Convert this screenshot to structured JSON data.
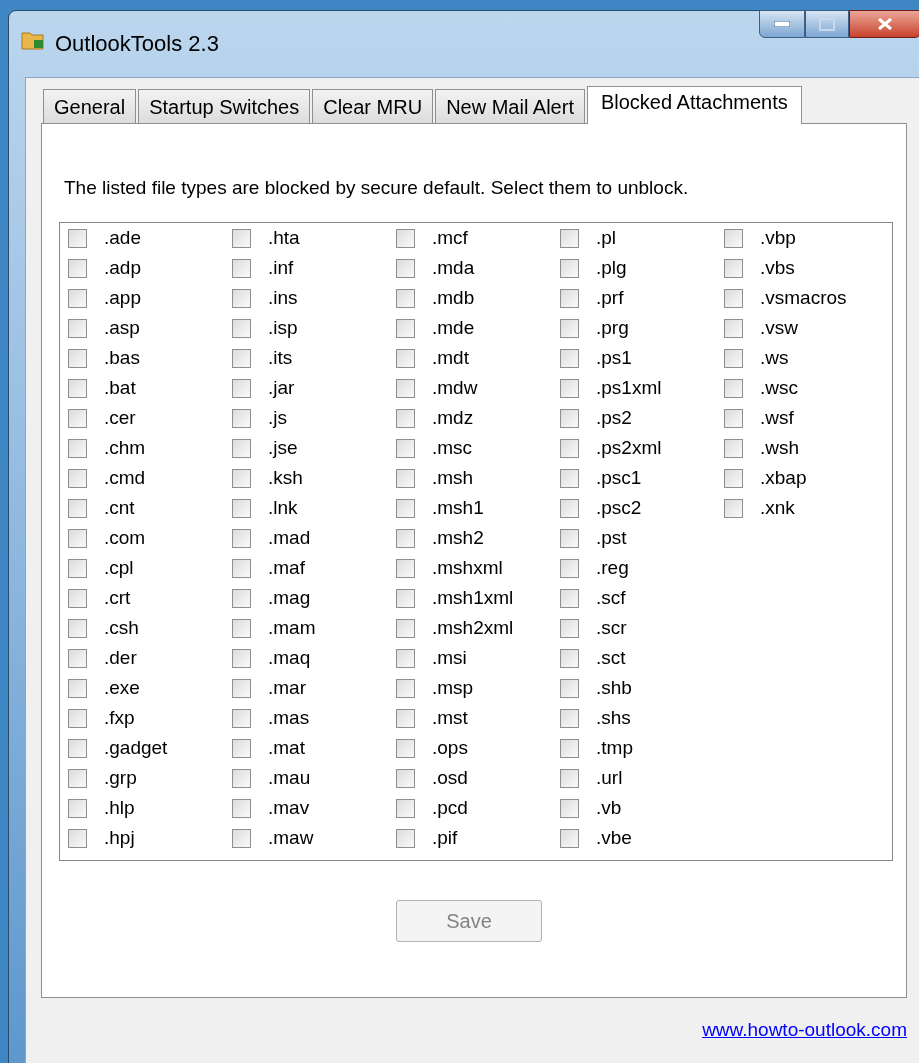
{
  "window": {
    "title": "OutlookTools 2.3"
  },
  "tabs": [
    {
      "label": "General",
      "selected": false
    },
    {
      "label": "Startup Switches",
      "selected": false
    },
    {
      "label": "Clear MRU",
      "selected": false
    },
    {
      "label": "New Mail Alert",
      "selected": false
    },
    {
      "label": "Blocked Attachments",
      "selected": true
    }
  ],
  "instructions": "The listed file types are blocked by secure default. Select them to unblock.",
  "file_types": [
    {
      "label": ".ade",
      "checked": false
    },
    {
      "label": ".adp",
      "checked": false
    },
    {
      "label": ".app",
      "checked": false
    },
    {
      "label": ".asp",
      "checked": false
    },
    {
      "label": ".bas",
      "checked": false
    },
    {
      "label": ".bat",
      "checked": false
    },
    {
      "label": ".cer",
      "checked": false
    },
    {
      "label": ".chm",
      "checked": false
    },
    {
      "label": ".cmd",
      "checked": false
    },
    {
      "label": ".cnt",
      "checked": false
    },
    {
      "label": ".com",
      "checked": false
    },
    {
      "label": ".cpl",
      "checked": false
    },
    {
      "label": ".crt",
      "checked": false
    },
    {
      "label": ".csh",
      "checked": false
    },
    {
      "label": ".der",
      "checked": false
    },
    {
      "label": ".exe",
      "checked": false
    },
    {
      "label": ".fxp",
      "checked": false
    },
    {
      "label": ".gadget",
      "checked": false
    },
    {
      "label": ".grp",
      "checked": false
    },
    {
      "label": ".hlp",
      "checked": false
    },
    {
      "label": ".hpj",
      "checked": false
    },
    {
      "label": ".hta",
      "checked": false
    },
    {
      "label": ".inf",
      "checked": false
    },
    {
      "label": ".ins",
      "checked": false
    },
    {
      "label": ".isp",
      "checked": false
    },
    {
      "label": ".its",
      "checked": false
    },
    {
      "label": ".jar",
      "checked": false
    },
    {
      "label": ".js",
      "checked": false
    },
    {
      "label": ".jse",
      "checked": false
    },
    {
      "label": ".ksh",
      "checked": false
    },
    {
      "label": ".lnk",
      "checked": false
    },
    {
      "label": ".mad",
      "checked": false
    },
    {
      "label": ".maf",
      "checked": false
    },
    {
      "label": ".mag",
      "checked": false
    },
    {
      "label": ".mam",
      "checked": false
    },
    {
      "label": ".maq",
      "checked": false
    },
    {
      "label": ".mar",
      "checked": false
    },
    {
      "label": ".mas",
      "checked": false
    },
    {
      "label": ".mat",
      "checked": false
    },
    {
      "label": ".mau",
      "checked": false
    },
    {
      "label": ".mav",
      "checked": false
    },
    {
      "label": ".maw",
      "checked": false
    },
    {
      "label": ".mcf",
      "checked": false
    },
    {
      "label": ".mda",
      "checked": false
    },
    {
      "label": ".mdb",
      "checked": false
    },
    {
      "label": ".mde",
      "checked": false
    },
    {
      "label": ".mdt",
      "checked": false
    },
    {
      "label": ".mdw",
      "checked": false
    },
    {
      "label": ".mdz",
      "checked": false
    },
    {
      "label": ".msc",
      "checked": false
    },
    {
      "label": ".msh",
      "checked": false
    },
    {
      "label": ".msh1",
      "checked": false
    },
    {
      "label": ".msh2",
      "checked": false
    },
    {
      "label": ".mshxml",
      "checked": false
    },
    {
      "label": ".msh1xml",
      "checked": false
    },
    {
      "label": ".msh2xml",
      "checked": false
    },
    {
      "label": ".msi",
      "checked": false
    },
    {
      "label": ".msp",
      "checked": false
    },
    {
      "label": ".mst",
      "checked": false
    },
    {
      "label": ".ops",
      "checked": false
    },
    {
      "label": ".osd",
      "checked": false
    },
    {
      "label": ".pcd",
      "checked": false
    },
    {
      "label": ".pif",
      "checked": false
    },
    {
      "label": ".pl",
      "checked": false
    },
    {
      "label": ".plg",
      "checked": false
    },
    {
      "label": ".prf",
      "checked": false
    },
    {
      "label": ".prg",
      "checked": false
    },
    {
      "label": ".ps1",
      "checked": false
    },
    {
      "label": ".ps1xml",
      "checked": false
    },
    {
      "label": ".ps2",
      "checked": false
    },
    {
      "label": ".ps2xml",
      "checked": false
    },
    {
      "label": ".psc1",
      "checked": false
    },
    {
      "label": ".psc2",
      "checked": false
    },
    {
      "label": ".pst",
      "checked": false
    },
    {
      "label": ".reg",
      "checked": false
    },
    {
      "label": ".scf",
      "checked": false
    },
    {
      "label": ".scr",
      "checked": false
    },
    {
      "label": ".sct",
      "checked": false
    },
    {
      "label": ".shb",
      "checked": false
    },
    {
      "label": ".shs",
      "checked": false
    },
    {
      "label": ".tmp",
      "checked": false
    },
    {
      "label": ".url",
      "checked": false
    },
    {
      "label": ".vb",
      "checked": false
    },
    {
      "label": ".vbe",
      "checked": false
    },
    {
      "label": ".vbp",
      "checked": false
    },
    {
      "label": ".vbs",
      "checked": false
    },
    {
      "label": ".vsmacros",
      "checked": false
    },
    {
      "label": ".vsw",
      "checked": false
    },
    {
      "label": ".ws",
      "checked": false
    },
    {
      "label": ".wsc",
      "checked": false
    },
    {
      "label": ".wsf",
      "checked": false
    },
    {
      "label": ".wsh",
      "checked": false
    },
    {
      "label": ".xbap",
      "checked": false
    },
    {
      "label": ".xnk",
      "checked": false
    }
  ],
  "save_button": {
    "label": "Save",
    "disabled": true
  },
  "link": "www.howto-outlook.com"
}
